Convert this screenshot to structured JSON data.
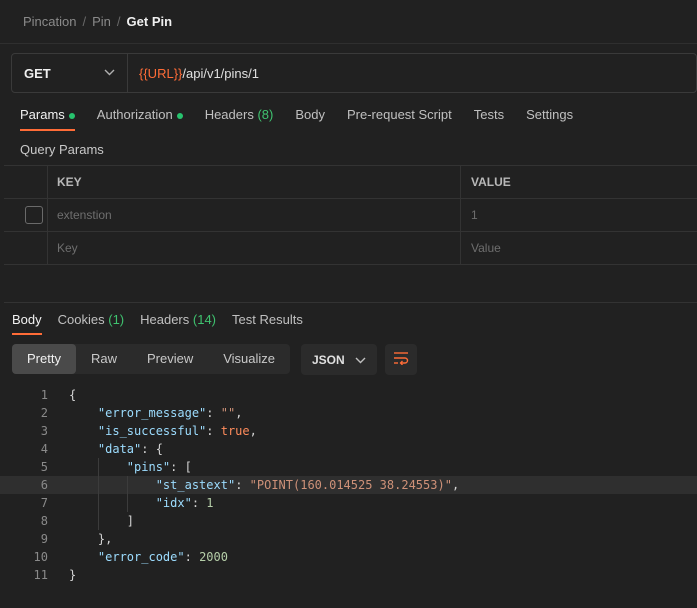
{
  "breadcrumb": [
    "Pincation",
    "Pin",
    "Get Pin"
  ],
  "request": {
    "method": "GET",
    "url_var": "{{URL}}",
    "url_path": "/api/v1/pins/1"
  },
  "request_tabs": {
    "params": "Params",
    "authorization": "Authorization",
    "headers": "Headers",
    "headers_count": "(8)",
    "body": "Body",
    "prerequest": "Pre-request Script",
    "tests": "Tests",
    "settings": "Settings"
  },
  "query_params": {
    "title": "Query Params",
    "col_key": "KEY",
    "col_value": "VALUE",
    "rows": [
      {
        "key": "extenstion",
        "value": "1"
      }
    ],
    "placeholder_key": "Key",
    "placeholder_value": "Value"
  },
  "response_tabs": {
    "body": "Body",
    "cookies": "Cookies",
    "cookies_count": "(1)",
    "headers": "Headers",
    "headers_count": "(14)",
    "test_results": "Test Results"
  },
  "view_modes": [
    "Pretty",
    "Raw",
    "Preview",
    "Visualize"
  ],
  "format": "JSON",
  "code_lines": [
    "1",
    "2",
    "3",
    "4",
    "5",
    "6",
    "7",
    "8",
    "9",
    "10",
    "11"
  ],
  "json": {
    "error_message_key": "\"error_message\"",
    "error_message_val": "\"\"",
    "is_successful_key": "\"is_successful\"",
    "is_successful_val": "true",
    "data_key": "\"data\"",
    "pins_key": "\"pins\"",
    "st_astext_key": "\"st_astext\"",
    "st_astext_val": "\"POINT(160.014525 38.24553)\"",
    "idx_key": "\"idx\"",
    "idx_val": "1",
    "error_code_key": "\"error_code\"",
    "error_code_val": "2000"
  },
  "colors": {
    "accent": "#ff6c37",
    "success_dot": "#27c36e"
  }
}
